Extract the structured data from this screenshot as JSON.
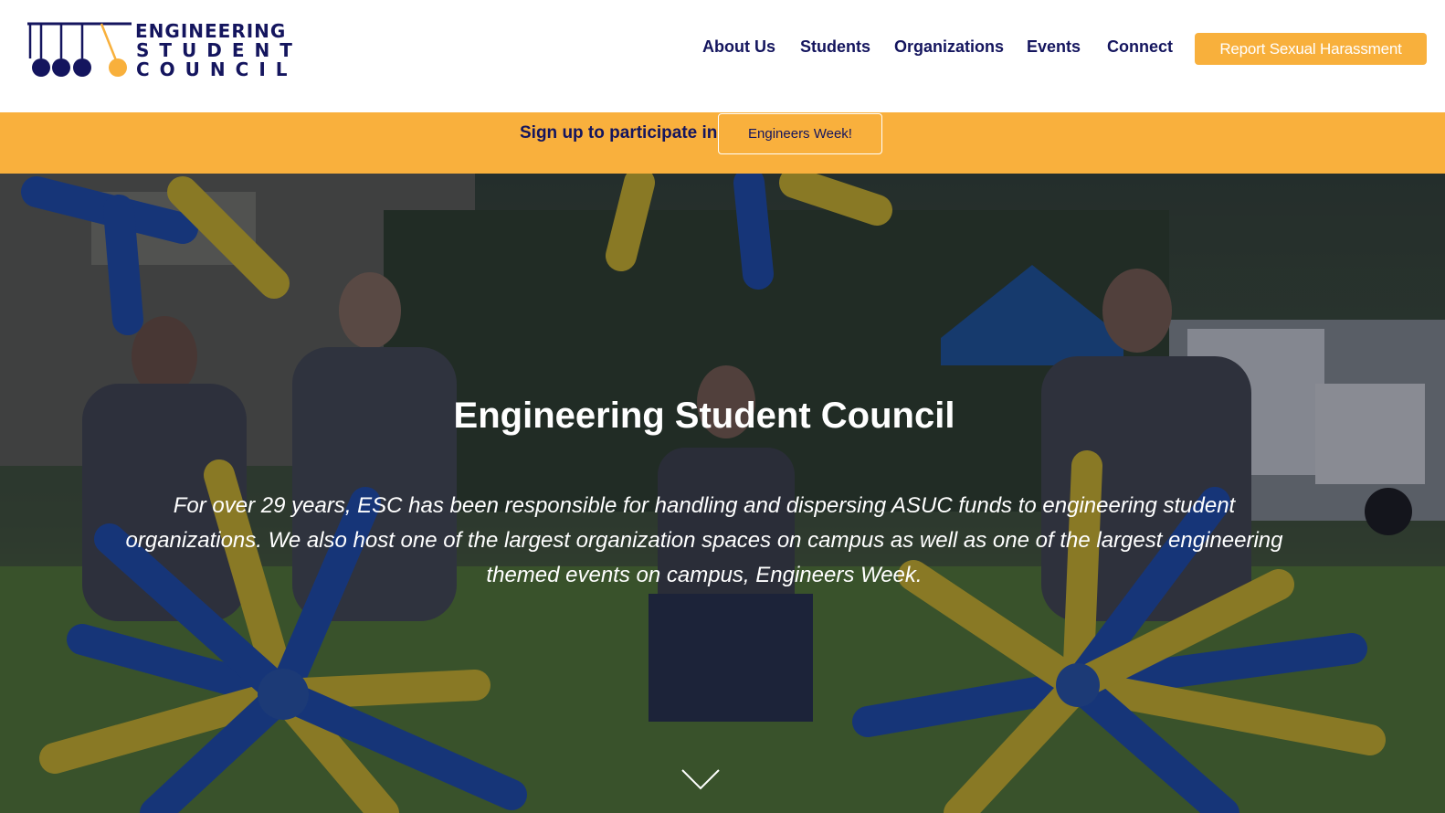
{
  "logo": {
    "line1": "ENGINEERING",
    "line2": "STUDENT",
    "line3": "COUNCIL"
  },
  "nav": {
    "items": [
      {
        "label": "About Us"
      },
      {
        "label": "Students"
      },
      {
        "label": "Organizations"
      },
      {
        "label": "Events"
      },
      {
        "label": "Connect"
      }
    ],
    "cta_label": "Report Sexual Harassment"
  },
  "banner": {
    "text": "Sign up to participate in",
    "button_label": "Engineers Week!"
  },
  "hero": {
    "title": "Engineering Student Council",
    "description": "For over 29 years, ESC has been responsible for handling and dispersing ASUC funds to engineering student organizations. We also host one of the largest organization spaces on campus as well as one of the largest engineering themed events on campus, Engineers Week.",
    "scroll_icon": "chevron-down-icon"
  },
  "colors": {
    "navy": "#14155e",
    "gold": "#f8b03c",
    "white": "#ffffff"
  }
}
